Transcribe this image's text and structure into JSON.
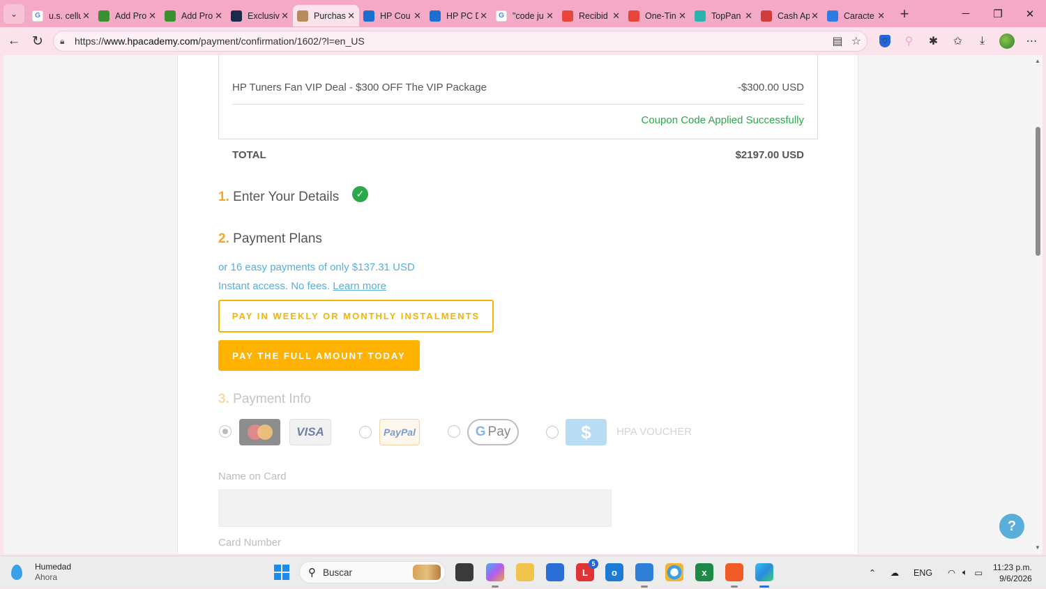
{
  "browser": {
    "tabs": [
      {
        "title": "u.s. cellu",
        "favicon": "google-icon",
        "color": "#ffffff"
      },
      {
        "title": "Add Pro",
        "favicon": "extension-green-icon",
        "color": "#3a8f2e"
      },
      {
        "title": "Add Pro",
        "favicon": "extension-green-icon",
        "color": "#3a8f2e"
      },
      {
        "title": "Exclusiv",
        "favicon": "hpt-icon",
        "color": "#1a2a4a"
      },
      {
        "title": "Purchas",
        "favicon": "hpa-icon",
        "color": "#b88a5a",
        "active": true
      },
      {
        "title": "HP Cou",
        "favicon": "hp-icon",
        "color": "#1c6fd1"
      },
      {
        "title": "HP PC D",
        "favicon": "hp-icon",
        "color": "#1c6fd1"
      },
      {
        "title": "\"code ju",
        "favicon": "google-icon",
        "color": "#ffffff"
      },
      {
        "title": "Recibid",
        "favicon": "gmail-icon",
        "color": "#e8453c"
      },
      {
        "title": "One-Tin",
        "favicon": "gmail-icon",
        "color": "#e8453c"
      },
      {
        "title": "TopPan",
        "favicon": "toppan-icon",
        "color": "#2bb3b0"
      },
      {
        "title": "Cash Ap",
        "favicon": "rc-icon",
        "color": "#d23b3b"
      },
      {
        "title": "Caracte",
        "favicon": "text-icon",
        "color": "#2f7be0"
      }
    ],
    "tab_symbols": {
      "close": "✕",
      "new": "+",
      "list": "⌄"
    },
    "window_controls": {
      "minimize": "─",
      "maximize": "❐",
      "close": "✕"
    },
    "address": {
      "url_prefix": "https://",
      "url_host": "www.hpacademy.com",
      "url_path": "/payment/confirmation/1602/?l=en_US"
    }
  },
  "order": {
    "discount_label": "HP Tuners Fan VIP Deal - $300 OFF The VIP Package",
    "discount_value": "-$300.00 USD",
    "coupon_message": "Coupon Code Applied Successfully",
    "total_label": "TOTAL",
    "total_value": "$2197.00 USD"
  },
  "steps": {
    "details": {
      "num": "1.",
      "title": "Enter Your Details",
      "completed": true
    },
    "plans": {
      "num": "2.",
      "title": "Payment Plans"
    },
    "info": {
      "num": "3.",
      "title": "Payment Info"
    }
  },
  "plans": {
    "line1": "or 16 easy payments of only $137.31 USD",
    "line2": "Instant access. No fees.",
    "learn_more": "Learn more",
    "installments_button": "PAY IN WEEKLY OR MONTHLY INSTALMENTS",
    "full_button": "PAY THE FULL AMOUNT TODAY"
  },
  "payment_methods": {
    "selected": "card",
    "mastercard": "MasterCard",
    "visa": "VISA",
    "paypal": "PayPal",
    "gpay_g": "G",
    "gpay": "Pay",
    "voucher_symbol": "$",
    "voucher_label": "HPA VOUCHER"
  },
  "form": {
    "name_label": "Name on Card",
    "name_value": "",
    "card_label": "Card Number"
  },
  "help": {
    "symbol": "?"
  },
  "taskbar": {
    "weather_title": "Humedad",
    "weather_sub": "Ahora",
    "search_placeholder": "Buscar",
    "lang": "ENG",
    "time": "11:23 p.m.",
    "date": "9/6/2026",
    "notification_badge": "5"
  },
  "colors": {
    "accent": "#f5a623",
    "button": "#ffb300",
    "success": "#2aa84a",
    "link": "#5aaedc",
    "tab_bar": "#f4a9c6"
  }
}
